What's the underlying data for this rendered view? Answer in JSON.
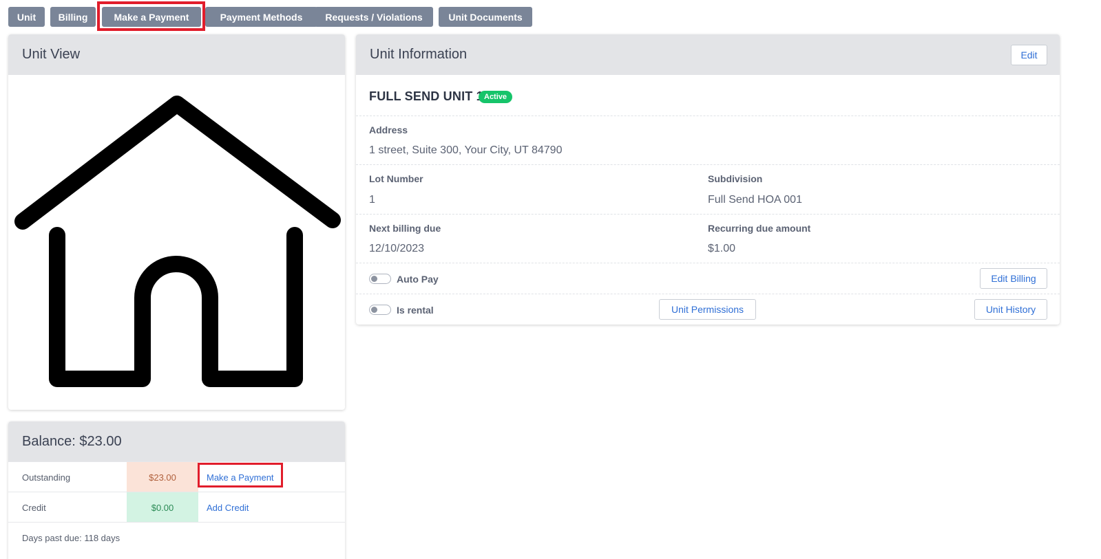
{
  "tabs": [
    {
      "label": "Unit"
    },
    {
      "label": "Billing"
    },
    {
      "label": "Make a Payment"
    },
    {
      "label": "Payment Methods"
    },
    {
      "label": "Requests / Violations"
    },
    {
      "label": "Unit Documents"
    }
  ],
  "unit_view": {
    "title": "Unit View",
    "image_icon": "house-icon"
  },
  "balance": {
    "title": "Balance: $23.00",
    "rows": [
      {
        "label": "Outstanding",
        "amount": "$23.00",
        "action": "Make a Payment"
      },
      {
        "label": "Credit",
        "amount": "$0.00",
        "action": "Add Credit"
      }
    ],
    "days_past_due": "Days past due: 118 days"
  },
  "unit_info": {
    "title": "Unit Information",
    "edit_label": "Edit",
    "unit_name": "FULL SEND UNIT 1",
    "status": "Active",
    "address_label": "Address",
    "address_value": "1 street, Suite 300, Your City, UT 84790",
    "lot_label": "Lot Number",
    "lot_value": "1",
    "subdivision_label": "Subdivision",
    "subdivision_value": "Full Send HOA 001",
    "next_billing_label": "Next billing due",
    "next_billing_value": "12/10/2023",
    "recurring_label": "Recurring due amount",
    "recurring_value": "$1.00",
    "autopay_label": "Auto Pay",
    "edit_billing_label": "Edit Billing",
    "rental_label": "Is rental",
    "permissions_label": "Unit Permissions",
    "history_label": "Unit History"
  },
  "colors": {
    "tab_bg": "#7a8598",
    "highlight": "#e11d2b",
    "link": "#2f6fd6",
    "active_badge": "#16c46a",
    "outstanding_bg": "#fbe3d8",
    "credit_bg": "#d3f3e3"
  }
}
